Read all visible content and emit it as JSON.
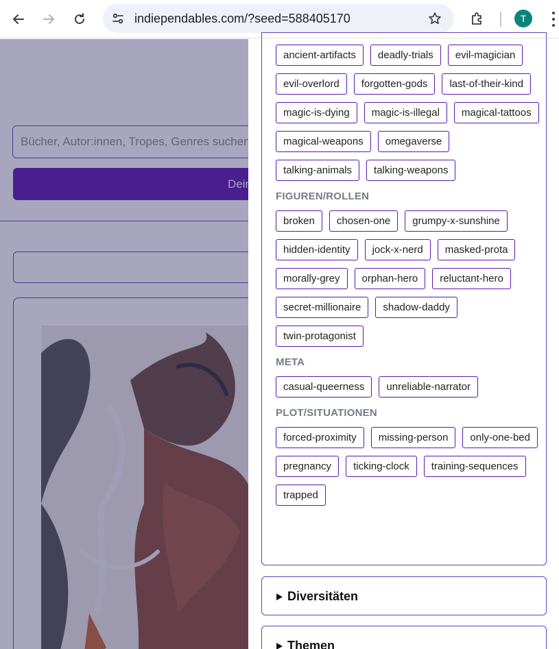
{
  "browser": {
    "url": "indiependables.com/?seed=588405170",
    "profile_initial": "T"
  },
  "background": {
    "search_placeholder": "Bücher, Autor:innen, Tropes, Genres suchen",
    "search_button_label": "Dein"
  },
  "panel": {
    "fantasy_tags": [
      "ancient-artifacts",
      "deadly-trials",
      "evil-magician",
      "evil-overlord",
      "forgotten-gods",
      "last-of-their-kind",
      "magic-is-dying",
      "magic-is-illegal",
      "magical-tattoos",
      "magical-weapons",
      "omegaverse",
      "talking-animals",
      "talking-weapons"
    ],
    "sections": [
      {
        "title": "FIGUREN/ROLLEN",
        "tags": [
          "broken",
          "chosen-one",
          "grumpy-x-sunshine",
          "hidden-identity",
          "jock-x-nerd",
          "masked-prota",
          "morally-grey",
          "orphan-hero",
          "reluctant-hero",
          "secret-millionaire",
          "shadow-daddy",
          "twin-protagonist"
        ]
      },
      {
        "title": "META",
        "tags": [
          "casual-queerness",
          "unreliable-narrator"
        ]
      },
      {
        "title": "PLOT/SITUATIONEN",
        "tags": [
          "forced-proximity",
          "missing-person",
          "only-one-bed",
          "pregnancy",
          "ticking-clock",
          "training-sequences",
          "trapped"
        ]
      }
    ],
    "collapsed_sections": [
      "Diversitäten",
      "Themen"
    ]
  },
  "colors": {
    "accent": "#5d16ad",
    "border": "#6a3fb5",
    "section_title": "#737c88",
    "avatar": "#0b8577"
  }
}
